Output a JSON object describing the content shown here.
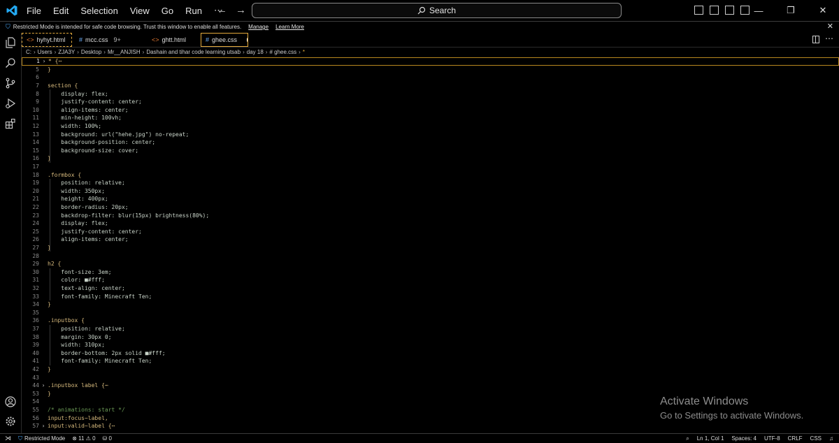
{
  "menu": {
    "items": [
      "File",
      "Edit",
      "Selection",
      "View",
      "Go",
      "Run",
      "⋯"
    ]
  },
  "search": {
    "label": "Search"
  },
  "banner": {
    "message": "Restricted Mode is intended for safe code browsing. Trust this window to enable all features.",
    "manage": "Manage",
    "learn_more": "Learn More"
  },
  "tabs": [
    {
      "label": "hyhyt.html",
      "icon": "<>",
      "badge": ""
    },
    {
      "label": "mcc.css",
      "icon": "#",
      "badge": "9+"
    },
    {
      "label": "ghtt.html",
      "icon": "<>",
      "badge": ""
    },
    {
      "label": "ghee.css",
      "icon": "#",
      "badge": ""
    }
  ],
  "breadcrumb": [
    "C:",
    "Users",
    "ZJA3Y",
    "Desktop",
    "Mr__ANJISH",
    "Dashain and tihar code learning utsab",
    "day 18",
    "# ghee.css",
    "*"
  ],
  "editor": {
    "lines": [
      {
        "n": "1",
        "fold": "›",
        "text": "* {⋯"
      },
      {
        "n": "5",
        "fold": "",
        "text": "}"
      },
      {
        "n": "6",
        "fold": "",
        "text": ""
      },
      {
        "n": "7",
        "fold": "",
        "text": "section {"
      },
      {
        "n": "8",
        "fold": "",
        "text": "    display: flex;"
      },
      {
        "n": "9",
        "fold": "",
        "text": "    justify-content: center;"
      },
      {
        "n": "10",
        "fold": "",
        "text": "    align-items: center;"
      },
      {
        "n": "11",
        "fold": "",
        "text": "    min-height: 100vh;"
      },
      {
        "n": "12",
        "fold": "",
        "text": "    width: 100%;"
      },
      {
        "n": "13",
        "fold": "",
        "text": "    background: url(\"hehe.jpg\") no-repeat;"
      },
      {
        "n": "14",
        "fold": "",
        "text": "    background-position: center;"
      },
      {
        "n": "15",
        "fold": "",
        "text": "    background-size: cover;"
      },
      {
        "n": "16",
        "fold": "",
        "text": "}"
      },
      {
        "n": "17",
        "fold": "",
        "text": ""
      },
      {
        "n": "18",
        "fold": "",
        "text": ".formbox {"
      },
      {
        "n": "19",
        "fold": "",
        "text": "    position: relative;"
      },
      {
        "n": "20",
        "fold": "",
        "text": "    width: 350px;"
      },
      {
        "n": "21",
        "fold": "",
        "text": "    height: 400px;"
      },
      {
        "n": "22",
        "fold": "",
        "text": "    border-radius: 20px;"
      },
      {
        "n": "23",
        "fold": "",
        "text": "    backdrop-filter: blur(15px) brightness(80%);"
      },
      {
        "n": "24",
        "fold": "",
        "text": "    display: flex;"
      },
      {
        "n": "25",
        "fold": "",
        "text": "    justify-content: center;"
      },
      {
        "n": "26",
        "fold": "",
        "text": "    align-items: center;"
      },
      {
        "n": "27",
        "fold": "",
        "text": "}"
      },
      {
        "n": "28",
        "fold": "",
        "text": ""
      },
      {
        "n": "29",
        "fold": "",
        "text": "h2 {"
      },
      {
        "n": "30",
        "fold": "",
        "text": "    font-size: 3em;"
      },
      {
        "n": "31",
        "fold": "",
        "text": "    color: ■#fff;"
      },
      {
        "n": "32",
        "fold": "",
        "text": "    text-align: center;"
      },
      {
        "n": "33",
        "fold": "",
        "text": "    font-family: Minecraft Ten;"
      },
      {
        "n": "34",
        "fold": "",
        "text": "}"
      },
      {
        "n": "35",
        "fold": "",
        "text": ""
      },
      {
        "n": "36",
        "fold": "",
        "text": ".inputbox {"
      },
      {
        "n": "37",
        "fold": "",
        "text": "    position: relative;"
      },
      {
        "n": "38",
        "fold": "",
        "text": "    margin: 30px 0;"
      },
      {
        "n": "39",
        "fold": "",
        "text": "    width: 310px;"
      },
      {
        "n": "40",
        "fold": "",
        "text": "    border-bottom: 2px solid ■#fff;"
      },
      {
        "n": "41",
        "fold": "",
        "text": "    font-family: Minecraft Ten;"
      },
      {
        "n": "42",
        "fold": "",
        "text": "}"
      },
      {
        "n": "43",
        "fold": "",
        "text": ""
      },
      {
        "n": "44",
        "fold": "›",
        "text": ".inputbox label {⋯"
      },
      {
        "n": "53",
        "fold": "",
        "text": "}"
      },
      {
        "n": "54",
        "fold": "",
        "text": ""
      },
      {
        "n": "55",
        "fold": "",
        "text": "/* animations: start */"
      },
      {
        "n": "56",
        "fold": "",
        "text": "input:focus~label,"
      },
      {
        "n": "57",
        "fold": "›",
        "text": "input:valid~label {⋯"
      }
    ]
  },
  "watermark": {
    "title": "Activate Windows",
    "subtitle": "Go to Settings to activate Windows."
  },
  "status": {
    "mode": "Restricted Mode",
    "errors": "⊗ 11 ⚠ 0",
    "ports": "⛁ 0",
    "position": "Ln 1, Col 1",
    "spaces": "Spaces: 4",
    "encoding": "UTF-8",
    "eol": "CRLF",
    "language": "CSS"
  },
  "colors": {
    "accent_tab_border": "#e2a93b",
    "vscode_blue": "#23a9f2",
    "background": "#000000"
  }
}
